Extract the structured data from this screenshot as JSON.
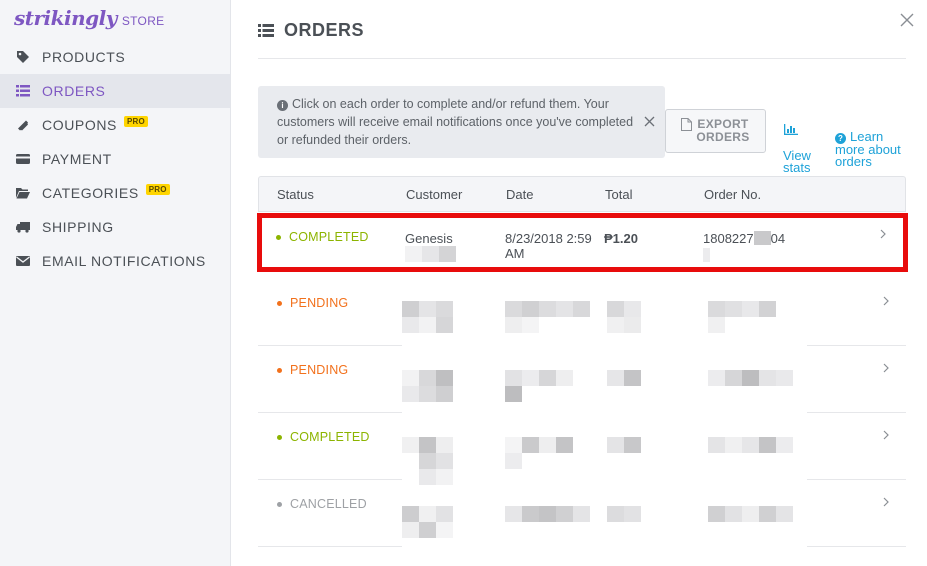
{
  "brand": {
    "logo_text": "strikingly",
    "logo_suffix": "STORE",
    "accent": "#7e57c2"
  },
  "sidebar": {
    "items": [
      {
        "label": "PRODUCTS",
        "icon": "tag-icon",
        "active": false,
        "pro": false
      },
      {
        "label": "ORDERS",
        "icon": "list-icon",
        "active": true,
        "pro": false
      },
      {
        "label": "COUPONS",
        "icon": "ticket-icon",
        "active": false,
        "pro": true
      },
      {
        "label": "PAYMENT",
        "icon": "credit-card-icon",
        "active": false,
        "pro": false
      },
      {
        "label": "CATEGORIES",
        "icon": "folder-icon",
        "active": false,
        "pro": true
      },
      {
        "label": "SHIPPING",
        "icon": "truck-icon",
        "active": false,
        "pro": false
      },
      {
        "label": "EMAIL NOTIFICATIONS",
        "icon": "envelope-icon",
        "active": false,
        "pro": false
      }
    ],
    "pro_badge": "PRO"
  },
  "page": {
    "title": "ORDERS"
  },
  "notice": {
    "text": "Click on each order to complete and/or refund them. Your customers will receive email notifications once you've completed or refunded their orders."
  },
  "actions": {
    "export_label": "EXPORT\nORDERS",
    "stats_label": "View\nstats",
    "learn_label": "Learn\nmore about\norders"
  },
  "table": {
    "columns": [
      "Status",
      "Customer",
      "Date",
      "Total",
      "Order No."
    ],
    "rows": [
      {
        "status": "COMPLETED",
        "status_color": "#8cb400",
        "customer": "Genesis",
        "date": "8/23/2018 2:59\nAM",
        "total": "₱1.20",
        "order_no": "1808227",
        "order_suffix": "04"
      },
      {
        "status": "PENDING",
        "status_color": "#f2711c"
      },
      {
        "status": "PENDING",
        "status_color": "#f2711c"
      },
      {
        "status": "COMPLETED",
        "status_color": "#8cb400"
      },
      {
        "status": "CANCELLED",
        "status_color": "#9ea1a5"
      }
    ]
  },
  "colors": {
    "link": "#1ea2d8",
    "highlight": "#e80c0c"
  }
}
